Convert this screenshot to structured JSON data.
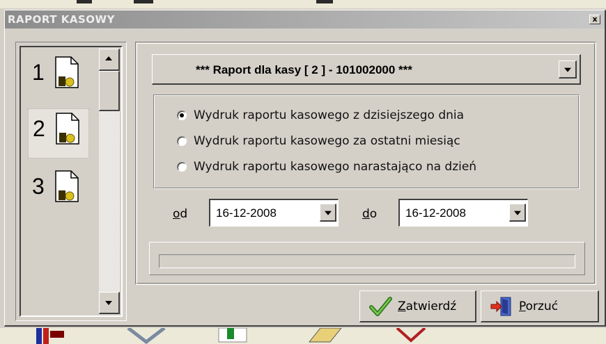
{
  "window": {
    "title": "RAPORT KASOWY",
    "close_label": "x"
  },
  "registers": [
    {
      "number": "1",
      "selected": false
    },
    {
      "number": "2",
      "selected": true
    },
    {
      "number": "3",
      "selected": false
    }
  ],
  "report_select": {
    "value": "***  Raport dla  kasy [ 2 ]  -  101002000  ***"
  },
  "options": [
    {
      "label": "Wydruk raportu kasowego z dzisiejszego dnia",
      "checked": true
    },
    {
      "label": "Wydruk raportu kasowego za ostatni miesiąc",
      "checked": false
    },
    {
      "label": "Wydruk raportu kasowego narastająco na dzień",
      "checked": false
    }
  ],
  "date_range": {
    "from_label_u": "o",
    "from_label_rest": "d",
    "from_value": "16-12-2008",
    "to_label_u": "d",
    "to_label_rest": "o",
    "to_value": "16-12-2008"
  },
  "progress": {
    "value": 0
  },
  "buttons": {
    "confirm_u": "Z",
    "confirm_rest": "atwierdź",
    "cancel_u": "P",
    "cancel_rest": "orzuć"
  },
  "colors": {
    "title_gradient_start": "#8c8c8c",
    "face": "#d4d0c8"
  }
}
